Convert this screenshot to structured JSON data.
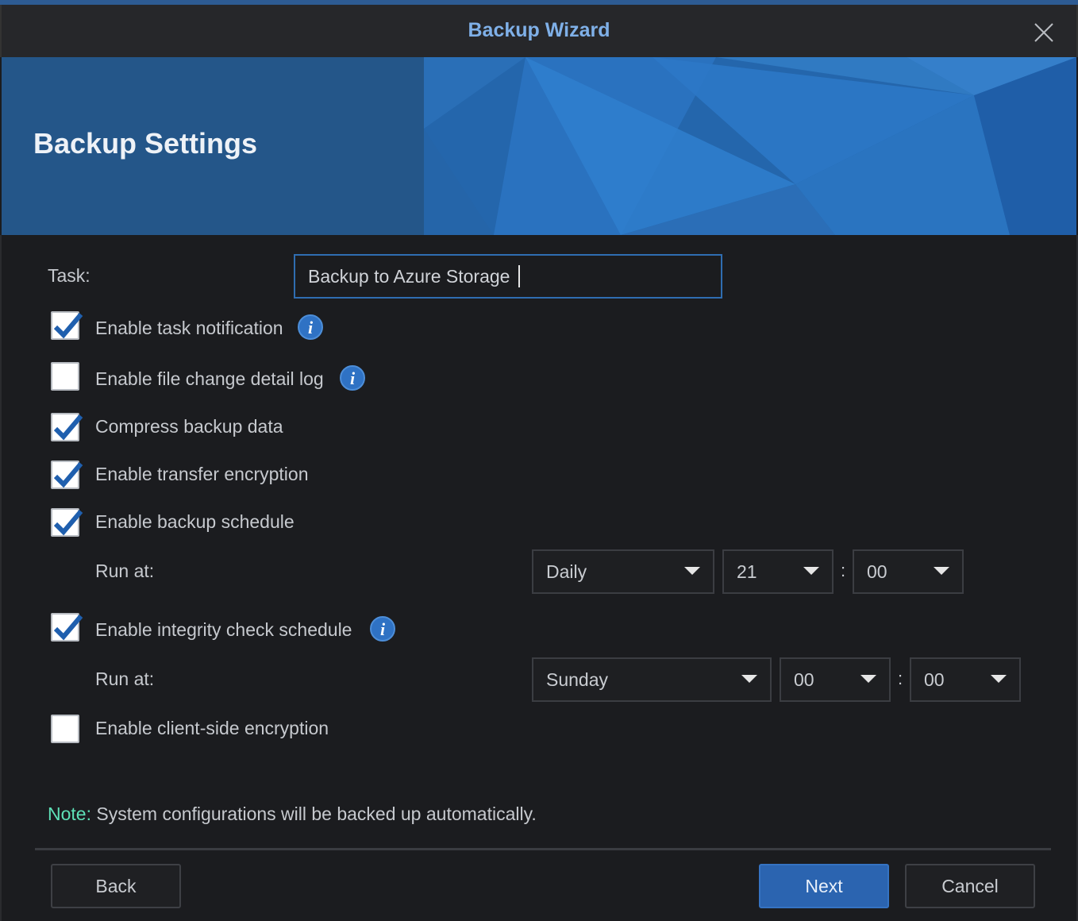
{
  "window": {
    "title": "Backup Wizard",
    "close_icon": "close-icon"
  },
  "banner": {
    "title": "Backup Settings"
  },
  "task": {
    "label": "Task:",
    "value": "Backup to Azure Storage"
  },
  "options": [
    {
      "label": "Enable task notification",
      "checked": true,
      "info": true
    },
    {
      "label": "Enable file change detail log",
      "checked": false,
      "info": true
    },
    {
      "label": "Compress backup data",
      "checked": true,
      "info": false
    },
    {
      "label": "Enable transfer encryption",
      "checked": true,
      "info": false
    },
    {
      "label": "Enable backup schedule",
      "checked": true,
      "info": false
    },
    {
      "label": "Enable integrity check schedule",
      "checked": true,
      "info": true
    },
    {
      "label": "Enable client-side encryption",
      "checked": false,
      "info": false
    }
  ],
  "backup_schedule": {
    "run_at_label": "Run at:",
    "frequency": "Daily",
    "hour": "21",
    "minute": "00",
    "separator": ":"
  },
  "integrity_schedule": {
    "run_at_label": "Run at:",
    "day": "Sunday",
    "hour": "00",
    "minute": "00",
    "separator": ":"
  },
  "note": {
    "label": "Note:",
    "text": " System configurations will be backed up automatically."
  },
  "buttons": {
    "back": "Back",
    "next": "Next",
    "cancel": "Cancel"
  },
  "colors": {
    "accent": "#2b64b0",
    "note": "#5ee0b7",
    "title": "#7fb0e8"
  }
}
